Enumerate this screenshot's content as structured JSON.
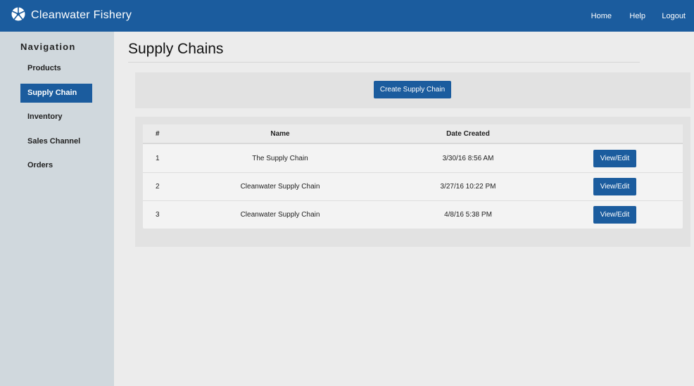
{
  "header": {
    "brand": "Cleanwater Fishery",
    "nav": [
      "Home",
      "Help",
      "Logout"
    ]
  },
  "sidebar": {
    "title": "Navigation",
    "items": [
      {
        "label": "Products",
        "active": false
      },
      {
        "label": "Supply Chain",
        "active": true
      },
      {
        "label": "Inventory",
        "active": false
      },
      {
        "label": "Sales Channel",
        "active": false
      },
      {
        "label": "Orders",
        "active": false
      }
    ]
  },
  "main": {
    "title": "Supply Chains",
    "create_label": "Create Supply Chain",
    "table": {
      "headers": [
        "#",
        "Name",
        "Date Created",
        ""
      ],
      "rows": [
        {
          "num": "1",
          "name": "The Supply Chain",
          "date": "3/30/16 8:56 AM",
          "action": "View/Edit"
        },
        {
          "num": "2",
          "name": "Cleanwater Supply Chain",
          "date": "3/27/16 10:22 PM",
          "action": "View/Edit"
        },
        {
          "num": "3",
          "name": "Cleanwater Supply Chain",
          "date": "4/8/16 5:38 PM",
          "action": "View/Edit"
        }
      ]
    }
  },
  "colors": {
    "primary": "#1b5c9e",
    "sidebar_bg": "#d0d8dd",
    "page_bg": "#ececec"
  },
  "icons": {
    "brand": "fish-logo-icon"
  }
}
